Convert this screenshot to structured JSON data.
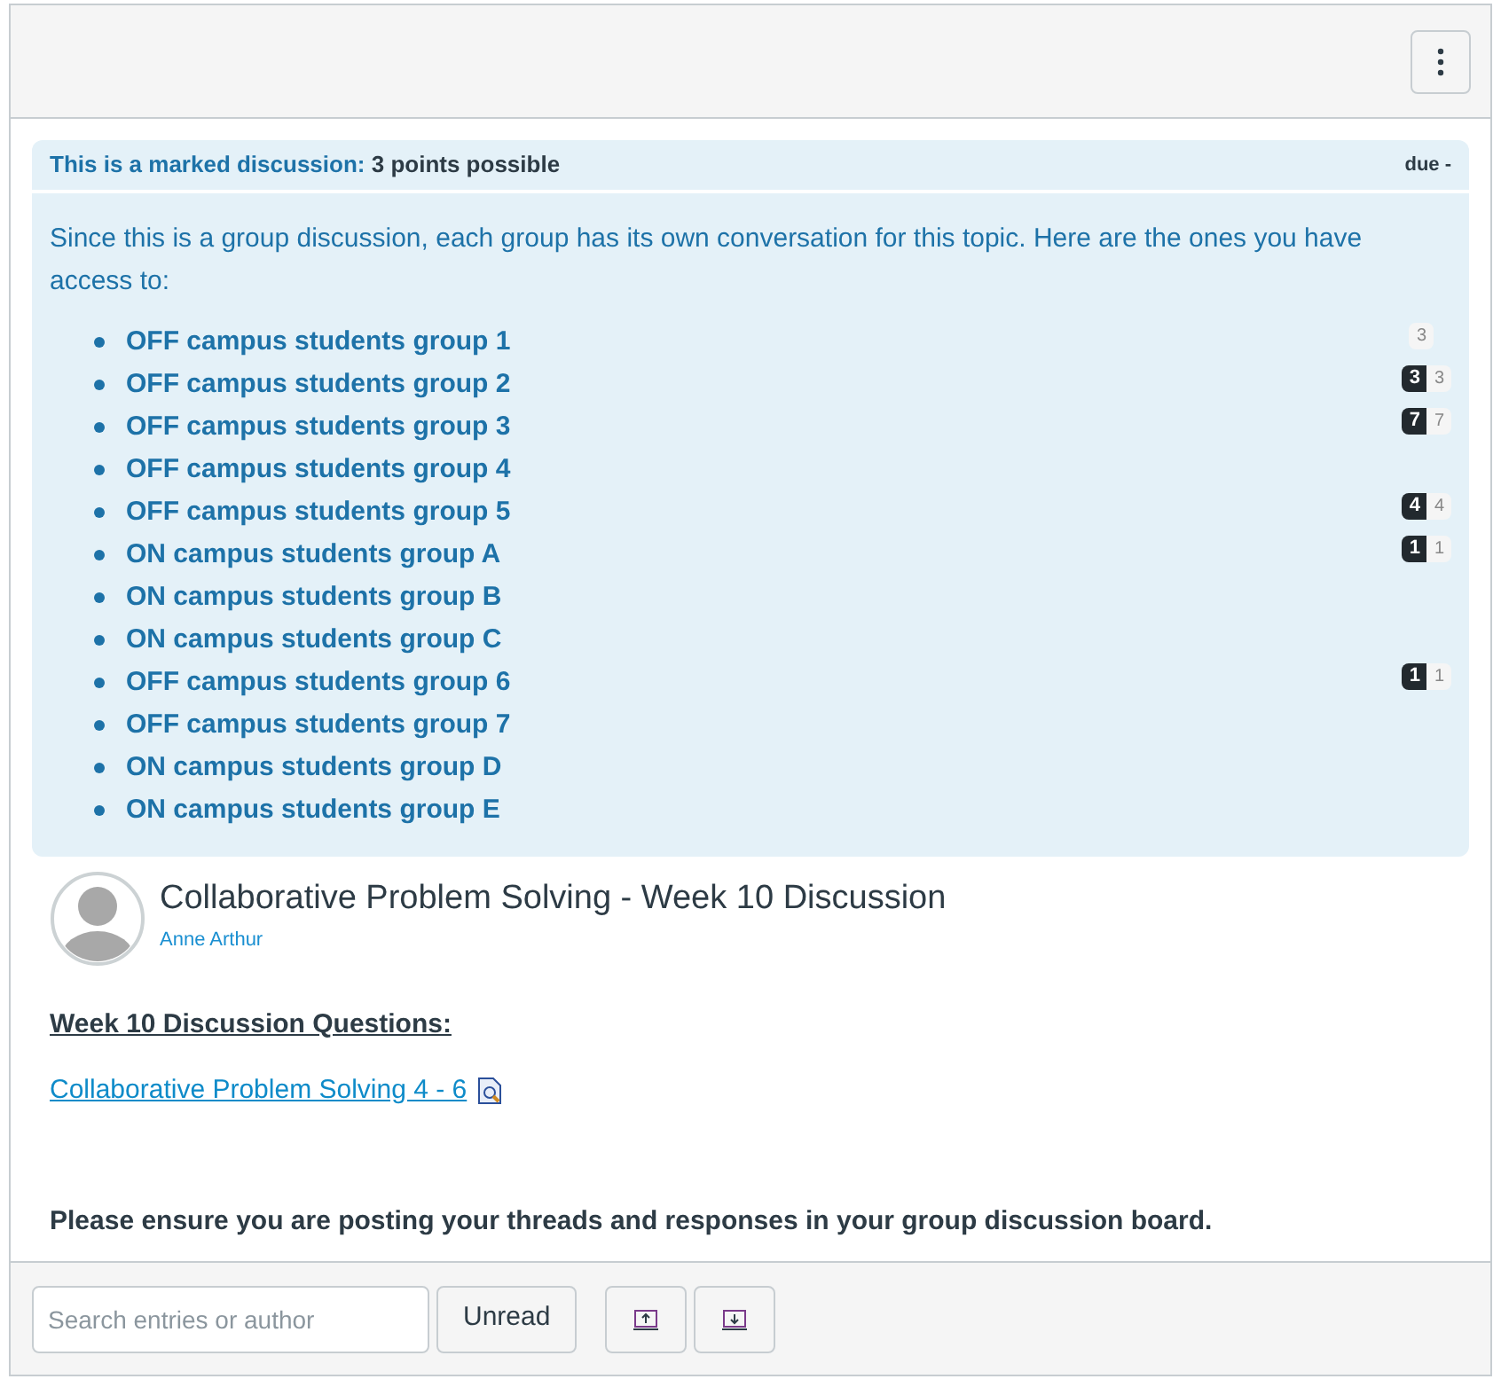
{
  "banner": {
    "label": "This is a marked discussion:",
    "points": "3 points possible",
    "due": "due -"
  },
  "intro": "Since this is a group discussion, each group has its own conversation for this topic. Here are the ones you have access to:",
  "groups": [
    {
      "name": "OFF campus students group 1",
      "total": "3"
    },
    {
      "name": "OFF campus students group 2",
      "unread": "3",
      "total": "3"
    },
    {
      "name": "OFF campus students group 3",
      "unread": "7",
      "total": "7"
    },
    {
      "name": "OFF campus students group 4"
    },
    {
      "name": "OFF campus students group 5",
      "unread": "4",
      "total": "4"
    },
    {
      "name": "ON campus students group A",
      "unread": "1",
      "total": "1"
    },
    {
      "name": "ON campus students group B"
    },
    {
      "name": "ON campus students group C"
    },
    {
      "name": "OFF campus students group 6",
      "unread": "1",
      "total": "1"
    },
    {
      "name": "OFF campus students group 7"
    },
    {
      "name": "ON campus students group D"
    },
    {
      "name": "ON campus students group E"
    }
  ],
  "topic": {
    "title": "Collaborative Problem Solving - Week 10 Discussion",
    "author": "Anne Arthur"
  },
  "body": {
    "heading": "Week 10 Discussion Questions:",
    "link": "Collaborative Problem Solving 4 - 6",
    "note": "Please ensure you are posting your threads and responses in your group discussion board."
  },
  "footer": {
    "search": {
      "placeholder": "Search entries or author"
    },
    "unread_button": "Unread"
  }
}
